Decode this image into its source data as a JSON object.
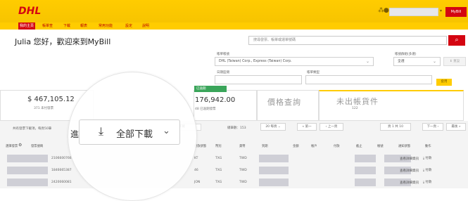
{
  "header": {
    "brand": "DHL",
    "user_label": "MyBill",
    "nav": [
      "我的主頁",
      "帳單查",
      "下載",
      "報表",
      "常用功能",
      "設定",
      "說明"
    ]
  },
  "page": {
    "greeting": "Julia 您好，歡迎來到MyBill",
    "search_placeholder": "搜尋發票、帳單或運單號碼"
  },
  "filters": {
    "account_label": "帳單帳號",
    "account_value": "DHL (Taiwan) Corp., Express (Taiwan) Corp.",
    "sublabel_right": "帳號群組(多選)",
    "select_right_value": "全選",
    "date_label": "日期區間",
    "type_label": "帳單類型",
    "apply_label": "套用",
    "reset_label": "重設"
  },
  "cards": {
    "balance_amount": "$ 467,105.12",
    "balance_sub": "371 未付發票",
    "overdue_amount": "176,942.00",
    "overdue_sub": "48 已逾期發票",
    "overdue_chip": "已逾期",
    "inquiry_title": "價格查詢",
    "unbilled_title": "未出帳貨件",
    "unbilled_sub": "122"
  },
  "toolbar": {
    "left_text": "共有發票下載項，每頁50筆",
    "zoom_left": "進",
    "zoom_download": "全部下載",
    "small_download": "全部下載",
    "total_label": "總筆數：153",
    "page_size": "20 每頁",
    "first": "« 第一",
    "prev": "‹ 上一頁",
    "page_info": "頁 1 共 10",
    "next": "下一頁 ›",
    "last": "最後 »"
  },
  "table": {
    "headers": [
      "選擇發票",
      "",
      "發票號碼",
      "",
      "",
      "",
      "",
      "付款狀態",
      "幣別",
      "貨幣",
      "到期",
      "金額",
      "帳戶",
      "付款",
      "截止",
      "帳號",
      "通知狀態",
      "",
      "動作"
    ],
    "rows": [
      {
        "invoice": "2106600766",
        "dept": "KT",
        "code": "TXG",
        "cur": "TWD",
        "action1": "查看詳細資訊",
        "action2": "付款"
      },
      {
        "invoice": "1846665387",
        "dept": "46",
        "code": "TXG",
        "cur": "TWD",
        "action1": "查看詳細資訊",
        "action2": "付款"
      },
      {
        "invoice": "2420060081",
        "dept": "JON",
        "code": "TXG",
        "cur": "TWD",
        "action1": "查看詳細資訊",
        "action2": "付款"
      }
    ]
  },
  "colors": {
    "brand_yellow": "#ffcc00",
    "brand_red": "#d40511",
    "overdue_green": "#3aa55a"
  }
}
